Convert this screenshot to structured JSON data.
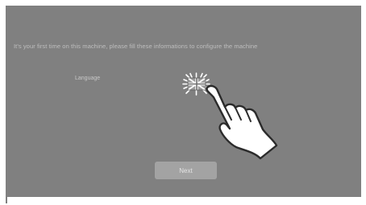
{
  "setup": {
    "intro_text": "It's your first time on this machine, please fill these informations to configure the machine",
    "language_label": "Language",
    "next_label": "Next"
  },
  "icons": {
    "flag": "uk-flag-icon",
    "hand": "pointing-hand-icon"
  },
  "colors": {
    "overlay": "#808080",
    "text": "#bdbdbd",
    "button": "#a3a3a3"
  }
}
